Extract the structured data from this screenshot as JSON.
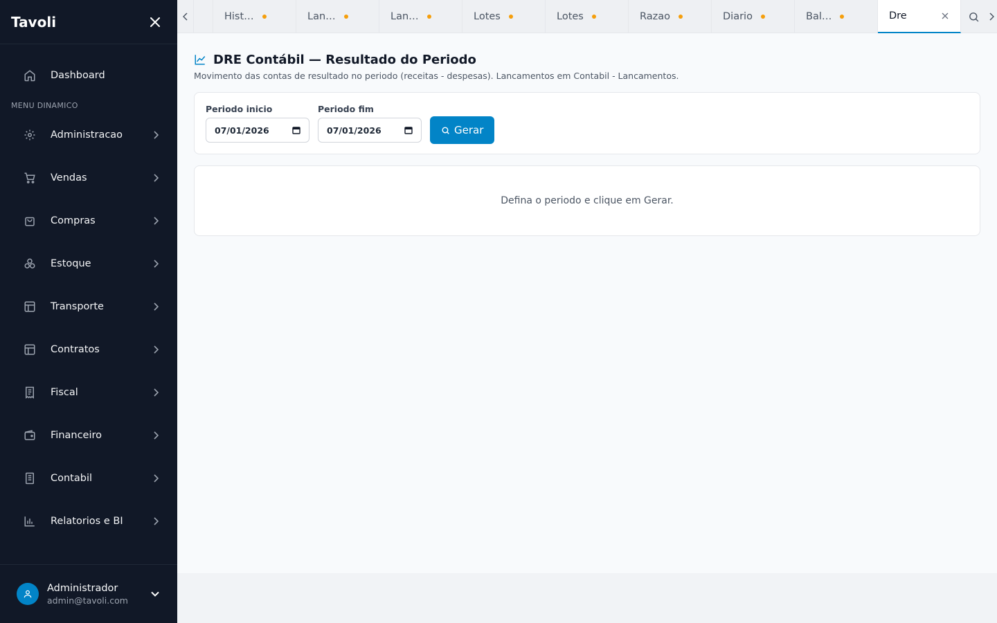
{
  "sidebar": {
    "brand": "Tavoli",
    "dashboard": "Dashboard",
    "section_label": "MENU DINAMICO",
    "items": [
      {
        "label": "Administracao",
        "icon": "gear-icon"
      },
      {
        "label": "Vendas",
        "icon": "cart-icon"
      },
      {
        "label": "Compras",
        "icon": "shopping-bag-icon"
      },
      {
        "label": "Estoque",
        "icon": "boxes-icon"
      },
      {
        "label": "Transporte",
        "icon": "layout-icon"
      },
      {
        "label": "Contratos",
        "icon": "layout-icon"
      },
      {
        "label": "Fiscal",
        "icon": "receipt-icon"
      },
      {
        "label": "Financeiro",
        "icon": "wallet-icon"
      },
      {
        "label": "Contabil",
        "icon": "book-icon"
      },
      {
        "label": "Relatorios e BI",
        "icon": "bar-chart-icon"
      }
    ],
    "user": {
      "name": "Administrador",
      "email": "admin@tavoli.com"
    }
  },
  "tabs": [
    {
      "label": "Hist…"
    },
    {
      "label": "Lan…"
    },
    {
      "label": "Lan…"
    },
    {
      "label": "Lotes"
    },
    {
      "label": "Lotes"
    },
    {
      "label": "Razao"
    },
    {
      "label": "Diario"
    },
    {
      "label": "Bal…"
    },
    {
      "label": "Dre",
      "active": true
    }
  ],
  "page": {
    "title": "DRE Contábil — Resultado do Periodo",
    "subtitle": "Movimento das contas de resultado no periodo (receitas - despesas). Lancamentos em Contabil - Lancamentos.",
    "filters": {
      "start_label": "Periodo inicio",
      "start_value": "07/01/2026",
      "end_label": "Periodo fim",
      "end_value": "07/01/2026",
      "button_label": "Gerar"
    },
    "empty_message": "Defina o periodo e clique em Gerar."
  },
  "colors": {
    "accent": "#0284c7",
    "sidebar_bg": "#111827",
    "unsaved_dot": "#f59e0b"
  }
}
